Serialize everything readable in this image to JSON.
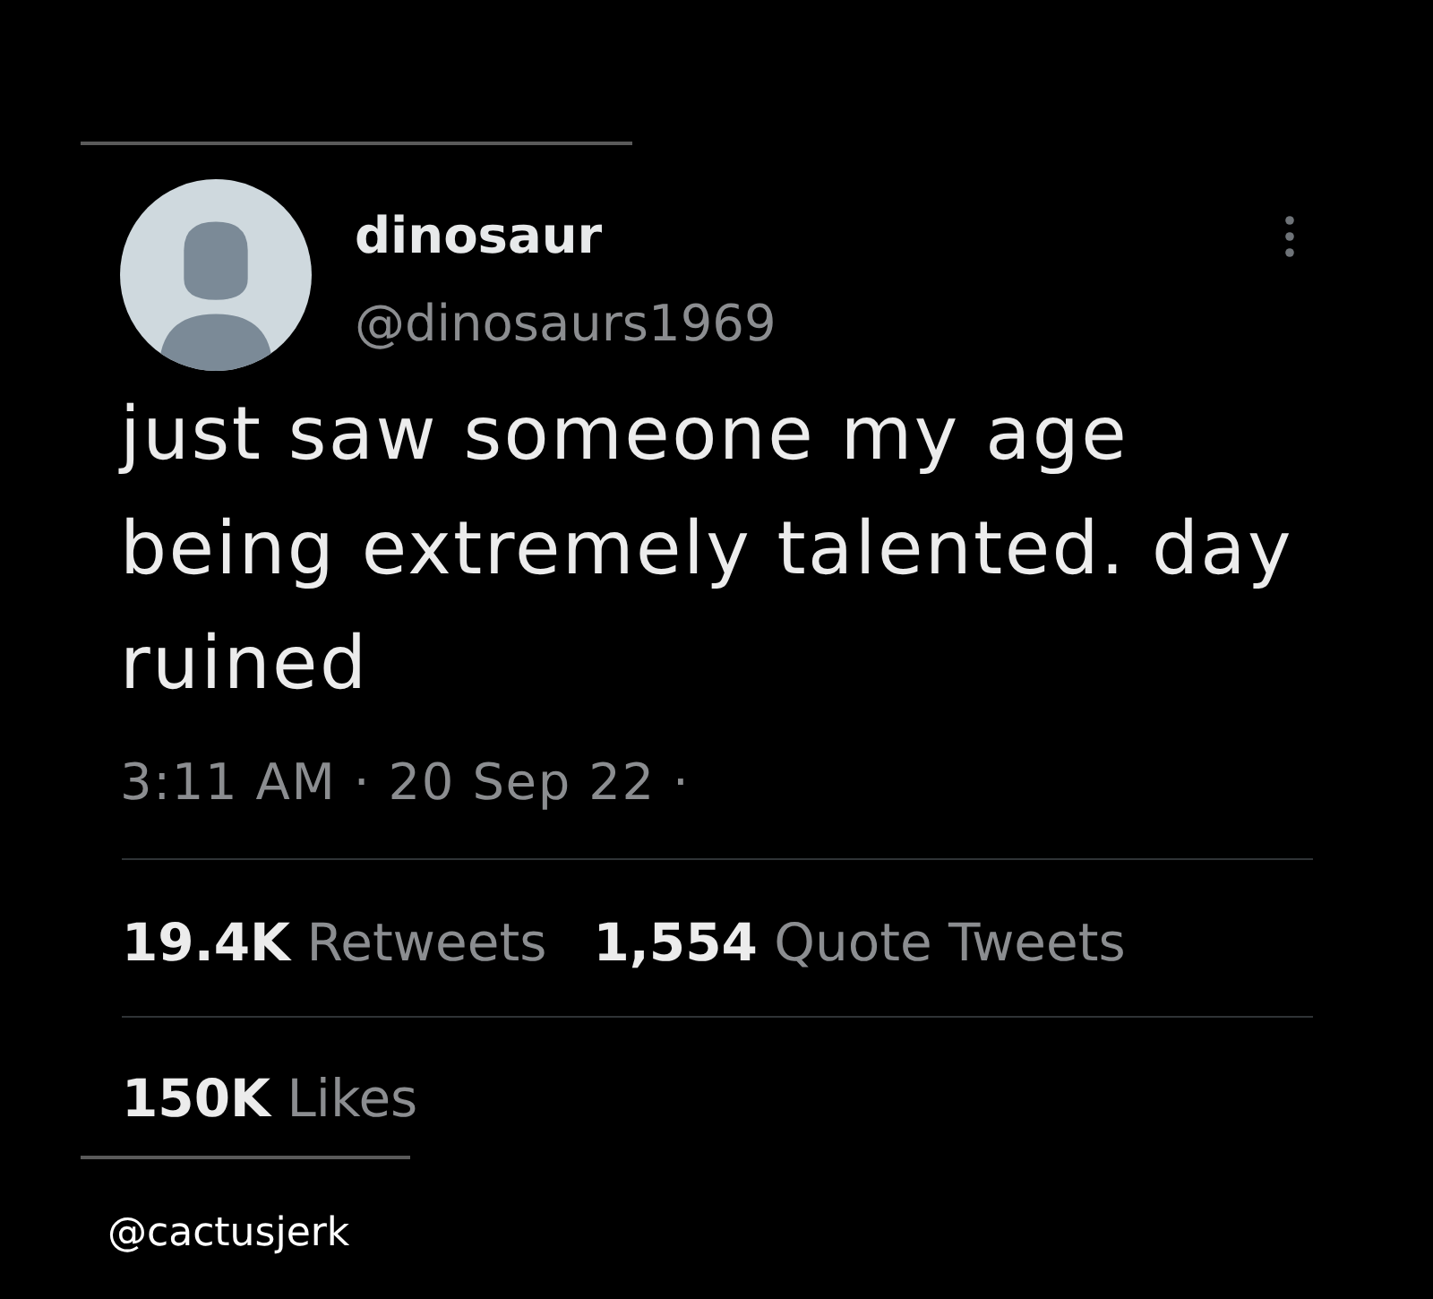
{
  "author": {
    "name": "dinosaur",
    "handle": "@dinosaurs1969"
  },
  "tweet": {
    "text": "just saw someone my age being extremely talented. day ruined",
    "timestamp": "3:11 AM · 20 Sep 22 ·"
  },
  "stat_rows": [
    [
      {
        "count": "19.4K",
        "label": "Retweets"
      },
      {
        "count": "1,554",
        "label": "Quote Tweets"
      }
    ],
    [
      {
        "count": "150K",
        "label": "Likes"
      }
    ]
  ],
  "credit": "@cactusjerk"
}
